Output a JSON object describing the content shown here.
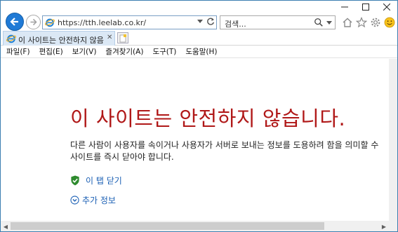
{
  "address_bar": {
    "url": "https://tth.leelab.co.kr/"
  },
  "search_bar": {
    "placeholder": "검색..."
  },
  "tab": {
    "title": "이 사이트는 안전하지 않음",
    "close": "✕"
  },
  "menu": {
    "items": [
      "파일(F)",
      "편집(E)",
      "보기(V)",
      "즐겨찾기(A)",
      "도구(T)",
      "도움말(H)"
    ]
  },
  "error_page": {
    "title": "이 사이트는 안전하지 않습니다.",
    "body_line1": "다른 사람이 사용자를 속이거나 사용자가 서버로 보내는 정보를 도용하려 함을 의미할 수",
    "body_line2": "사이트를 즉시 닫아야 합니다.",
    "close_tab": "이 탭 닫기",
    "more_info": "추가 정보"
  },
  "colors": {
    "title_red": "#b01818",
    "link_blue": "#1a5fb4",
    "shield_green": "#2e8b2e"
  },
  "icons": {
    "back": "arrow-left-icon",
    "forward": "arrow-right-icon",
    "ie": "ie-logo-icon",
    "refresh": "refresh-icon",
    "search": "search-icon",
    "home": "home-icon",
    "favorites": "star-icon",
    "settings": "gear-icon",
    "feedback": "smiley-icon",
    "shield": "shield-check-icon",
    "expand": "chevron-circle-down-icon"
  }
}
